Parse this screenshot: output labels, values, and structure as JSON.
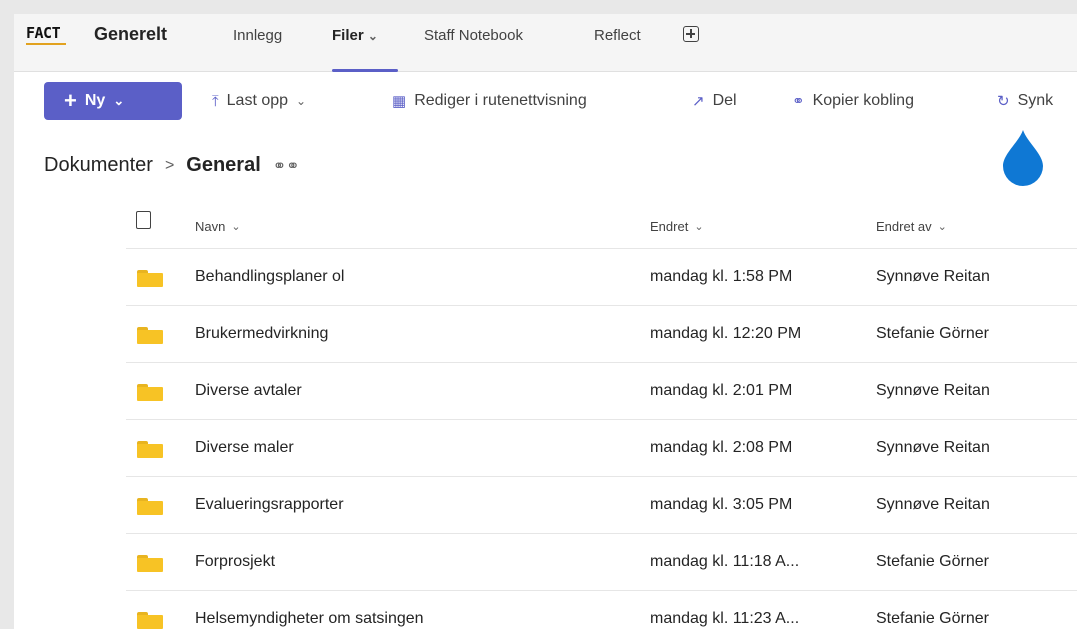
{
  "header": {
    "logo": "FACT",
    "channel": "Generelt",
    "tabs": [
      {
        "label": "Innlegg"
      },
      {
        "label": "Filer",
        "active": true
      },
      {
        "label": "Staff Notebook"
      },
      {
        "label": "Reflect"
      }
    ],
    "add_tab_icon": "plus-square-icon"
  },
  "toolbar": {
    "new_label": "Ny",
    "upload_label": "Last opp",
    "grid_label": "Rediger i rutenettvisning",
    "share_label": "Del",
    "copy_link_label": "Kopier kobling",
    "sync_label": "Synk"
  },
  "breadcrumb": {
    "root": "Dokumenter",
    "current": "General"
  },
  "table": {
    "columns": {
      "name": "Navn",
      "modified": "Endret",
      "modified_by": "Endret av"
    },
    "rows": [
      {
        "name": "Behandlingsplaner ol",
        "modified": "mandag kl. 1:58 PM",
        "modified_by": "Synnøve Reitan"
      },
      {
        "name": "Brukermedvirkning",
        "modified": "mandag kl. 12:20 PM",
        "modified_by": "Stefanie Görner"
      },
      {
        "name": "Diverse avtaler",
        "modified": "mandag kl. 2:01 PM",
        "modified_by": "Synnøve Reitan"
      },
      {
        "name": "Diverse maler",
        "modified": "mandag kl. 2:08 PM",
        "modified_by": "Synnøve Reitan"
      },
      {
        "name": "Evalueringsrapporter",
        "modified": "mandag kl. 3:05 PM",
        "modified_by": "Synnøve Reitan"
      },
      {
        "name": "Forprosjekt",
        "modified": "mandag kl. 11:18 A...",
        "modified_by": "Stefanie Görner"
      },
      {
        "name": "Helsemyndigheter om satsingen",
        "modified": "mandag kl. 11:23 A...",
        "modified_by": "Stefanie Görner"
      }
    ]
  },
  "colors": {
    "accent": "#5b5fc7",
    "folder": "#f7c325",
    "drop": "#0f78d4"
  }
}
